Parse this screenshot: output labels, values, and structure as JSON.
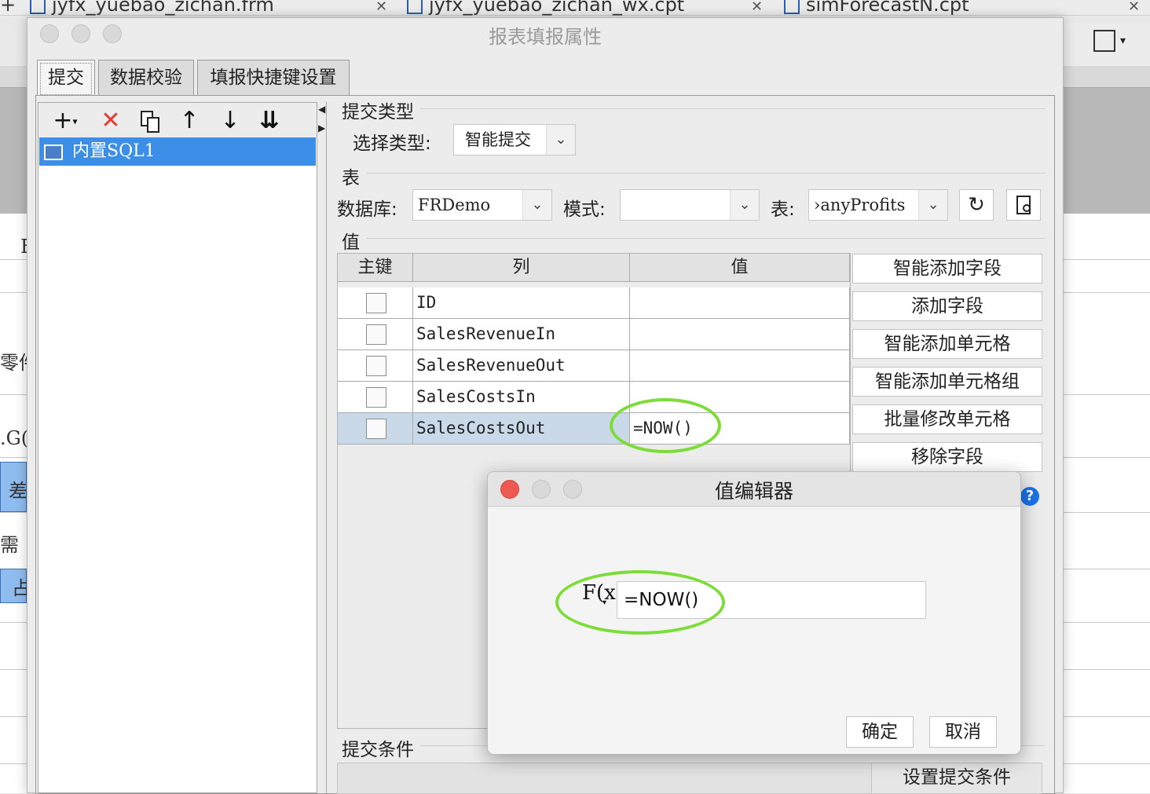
{
  "background": {
    "tabs": [
      "jyfx_yuebao_zichan.frm",
      "jyfx_yuebao_zichan_wx.cpt",
      "simForecastN.cpt"
    ],
    "fragments": [
      "E",
      "零件",
      ".G(",
      "差",
      "需",
      "占"
    ]
  },
  "dialog": {
    "title": "报表填报属性",
    "tabs": [
      "提交",
      "数据校验",
      "填报快捷键设置"
    ],
    "toolbar_icons": [
      "add-icon",
      "delete-icon",
      "copy-icon",
      "move-up-icon",
      "move-down-icon",
      "move-bottom-icon"
    ],
    "tree_items": [
      "内置SQL1"
    ],
    "submit_type": {
      "section": "提交类型",
      "label": "选择类型:",
      "value": "智能提交"
    },
    "table_section": {
      "section": "表",
      "db_label": "数据库:",
      "db_value": "FRDemo",
      "schema_label": "模式:",
      "schema_value": "",
      "table_label": "表:",
      "table_value": "›anyProfits"
    },
    "values_section": "值",
    "grid": {
      "headers": [
        "主键",
        "列",
        "值"
      ],
      "rows": [
        {
          "key": false,
          "column": "ID",
          "value": ""
        },
        {
          "key": false,
          "column": "SalesRevenueIn",
          "value": ""
        },
        {
          "key": false,
          "column": "SalesRevenueOut",
          "value": ""
        },
        {
          "key": false,
          "column": "SalesCostsIn",
          "value": ""
        },
        {
          "key": false,
          "column": "SalesCostsOut",
          "value": "=NOW()"
        }
      ]
    },
    "side_buttons": [
      "智能添加字段",
      "添加字段",
      "智能添加单元格",
      "智能添加单元格组",
      "批量修改单元格",
      "移除字段"
    ],
    "condition_section": "提交条件",
    "condition_button": "设置提交条件"
  },
  "value_editor": {
    "title": "值编辑器",
    "fx_label": "F(x)",
    "formula": "=NOW()",
    "ok": "确定",
    "cancel": "取消"
  },
  "colors": {
    "selection": "#3d8ee6",
    "highlight_ellipse": "#7ddc3a",
    "close_red": "#ee5a52"
  }
}
